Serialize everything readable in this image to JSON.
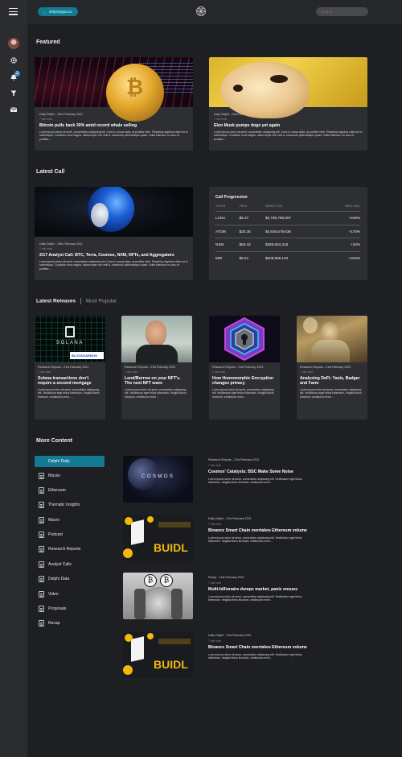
{
  "header": {
    "back_label": "delphidigital.io",
    "search_placeholder": "Search"
  },
  "rail": {
    "notification_count": "2"
  },
  "featured": {
    "title": "Featured",
    "cards": [
      {
        "meta": "Daily Delphi - 23rd February 2021",
        "read": "7 min read",
        "title": "Bitcoin pulls back 30% amid record whale selling",
        "body": "Lorem ipsum dolor sit amet, consectetur adipiscing elit. Cras in cursus diam, at porttitor nibh. Phasellus dapibus vitae est in scelerisque. Curabitur urna magna, ullamcorper non velit a, commodo pellentesque quam. Nulla interdum eu arcu et porttitor...."
      },
      {
        "meta": "Daily Delphi - 23rd February 2021",
        "read": "7 min read",
        "title": "Elon Musk pumps doge yet again",
        "body": "Lorem ipsum dolor sit amet, consectetur adipiscing elit. Cras in cursus diam, at porttitor nibh. Phasellus dapibus vitae est in scelerisque. Curabitur urna magna, ullamcorper non velit a, commodo pellentesque quam. Nulla interdum eu arcu et porttitor...."
      }
    ]
  },
  "latest_call": {
    "title": "Latest Call",
    "card": {
      "meta": "Daily Delphi - 20th February 2021",
      "read": "7 min read",
      "title": "2/17 Analyst Call: BTC, Terra, Cosmos, NXM, NFTs, and Aggregators",
      "body": "Lorem ipsum dolor sit amet, consectetur adipiscing elit. Cras in cursus diam, at porttitor nibh. Phasellus dapibus vitae est in scelerisque. Curabitur urna magna, ullamcorper non velit a, commodo pellentesque quam. Nulla interdum eu arcu et porttitor...."
    },
    "progression": {
      "title": "Call Progression",
      "headers": [
        "TICKER",
        "PRICE",
        "MARKET CAP",
        "SINCE CALL"
      ],
      "rows": [
        [
          "LUNA",
          "$6.37",
          "$2,708,788,007",
          "+240%"
        ],
        [
          "ATOM",
          "$20.35",
          "$4,926,678,636",
          "+170%"
        ],
        [
          "NXM",
          "$58.33",
          "$389,553,318",
          "+20%"
        ],
        [
          "MIR",
          "$5.61",
          "$208,998,133",
          "+310%"
        ]
      ]
    }
  },
  "releases": {
    "tab_active": "Latest Releases",
    "tab_idle": "Most Popular",
    "cards": [
      {
        "meta": "Research Reports - 21st February 2021",
        "read": "7 min read",
        "title": "Solana transactions don't require a second mortgage",
        "body": "Lorem ipsum dolor sit amet, consectetur adipiscing elit. Vestibulum eget tellus bibendum, fringilla libero tincidunt, vestibulum enim....",
        "img_text": "SOLANA",
        "img_text2": "BLOCKDAEMON"
      },
      {
        "meta": "Research Reports - 21st February 2021",
        "read": "7 min read",
        "title": "Lend/Borrow on your NFT's. The next NFT wave",
        "body": "Lorem ipsum dolor sit amet, consectetur adipiscing elit. Vestibulum eget tellus bibendum, fringilla libero tincidunt, vestibulum enim...."
      },
      {
        "meta": "Research Reports - 21st February 2021",
        "read": "7 min read",
        "title": "How Homomorphic Encryption changes privacy",
        "body": "Lorem ipsum dolor sit amet, consectetur adipiscing elit. Vestibulum eget tellus bibendum, fringilla libero tincidunt, vestibulum enim...."
      },
      {
        "meta": "Research Reports - 21st February 2021",
        "read": "7 min read",
        "title": "Analysing DeFi: Yaxis, Badger and Farm",
        "body": "Lorem ipsum dolor sit amet, consectetur adipiscing elit. Vestibulum eget tellus bibendum, fringilla libero tincidunt, vestibulum enim...."
      }
    ]
  },
  "more_content": {
    "title": "More Content",
    "categories": [
      "Delphi Daily",
      "Bitcoin",
      "Ethereum",
      "Thematic Insights",
      "Macro",
      "Podcast",
      "Research Reports",
      "Analyst Calls",
      "Delphi Data",
      "Video",
      "Proposals",
      "Recap"
    ],
    "articles": [
      {
        "meta": "Research Reports - 21st February 2021",
        "read": "7 min read",
        "title": "Cosmos' Catalysts: BSC Make Some Noise",
        "body": "Lorem ipsum dolor sit amet, consectetur adipiscing elit. Vestibulum eget tellus bibendum, fringilla libero tincidunt, vestibulum enim....",
        "img_text": "COSMOS"
      },
      {
        "meta": "Daily Delphi - 21st February 2021",
        "read": "7 min read",
        "title": "Binance Smart Chain overtakes Ethereum volume",
        "body": "Lorem ipsum dolor sit amet, consectetur adipiscing elit. Vestibulum eget tellus bibendum, fringilla libero tincidunt, vestibulum enim....",
        "img_text": "BUIDL"
      },
      {
        "meta": "Recap - 21st February 2021",
        "read": "7 min read",
        "title": "Multi-billionaire dumps market, panic ensues",
        "body": "Lorem ipsum dolor sit amet, consectetur adipiscing elit. Vestibulum eget tellus bibendum, fringilla libero tincidunt, vestibulum enim...."
      },
      {
        "meta": "Daily Delphi - 21st February 2021",
        "read": "7 min read",
        "title": "Binance Smart Chain overtakes Ethereum volume",
        "body": "Lorem ipsum dolor sit amet, consectetur adipiscing elit. Vestibulum eget tellus bibendum, fringilla libero tincidunt, vestibulum enim....",
        "img_text": "BUIDL"
      }
    ]
  },
  "colors": {
    "accent": "#137a94",
    "background": "#1e1f22",
    "card": "#2e2f33"
  }
}
